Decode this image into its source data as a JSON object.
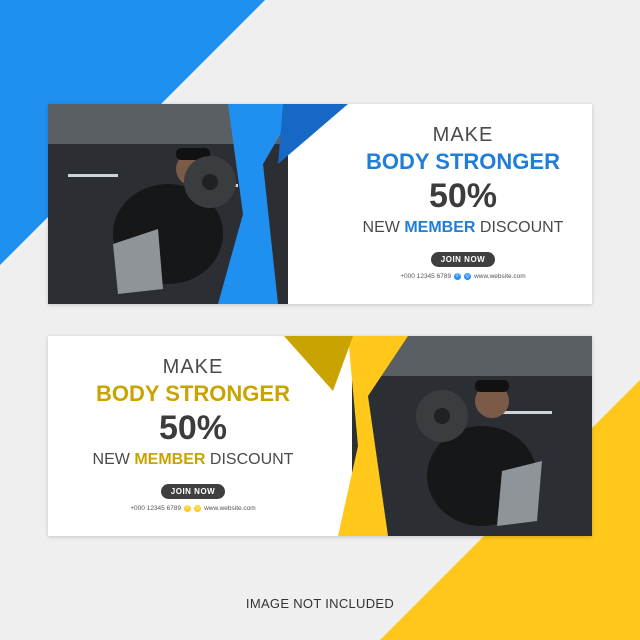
{
  "colors": {
    "background": "#efefef",
    "blue": "#1f8ff0",
    "blue_dark": "#1668c4",
    "yellow": "#ffc81a",
    "yellow_dark": "#c9a400",
    "text_dark": "#3c3c3c",
    "button": "#3f3f3f"
  },
  "banner_top": {
    "accent": "blue",
    "make": "MAKE",
    "headline": "BODY STRONGER",
    "percent": "50%",
    "member_prefix": "NEW",
    "member_highlight": "MEMBER",
    "member_suffix": "DISCOUNT",
    "button_label": "JOIN NOW",
    "phone": "+000 12345 6789",
    "website": "www.website.com",
    "icons": [
      "phone-icon",
      "globe-icon"
    ]
  },
  "banner_bottom": {
    "accent": "yellow",
    "make": "MAKE",
    "headline": "BODY STRONGER",
    "percent": "50%",
    "member_prefix": "NEW",
    "member_highlight": "MEMBER",
    "member_suffix": "DISCOUNT",
    "button_label": "JOIN NOW",
    "phone": "+000 12345 6789",
    "website": "www.website.com",
    "icons": [
      "phone-icon",
      "globe-icon"
    ]
  },
  "footer_note": "IMAGE NOT INCLUDED"
}
